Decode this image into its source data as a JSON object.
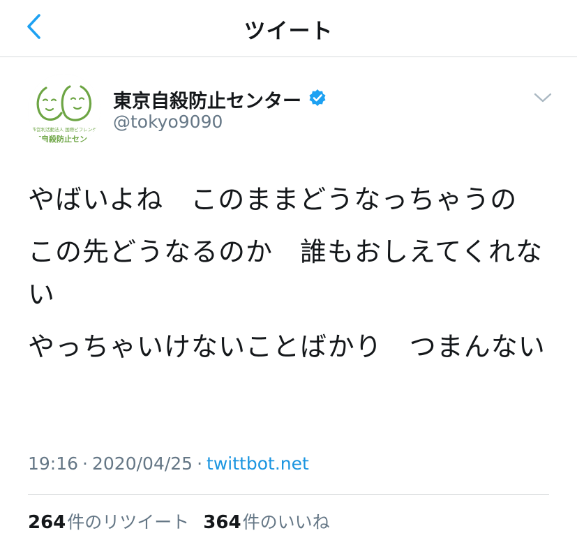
{
  "header": {
    "title": "ツイート",
    "back_icon": "chevron-left-icon",
    "accent_color": "#1da1f2"
  },
  "author": {
    "display_name": "東京自殺防止センター",
    "handle": "@tokyo9090",
    "verified": true,
    "avatar_caption_small": "特定非営利活動法人 国際ビフレンダーズ",
    "avatar_caption_large": "東京自殺防止センター"
  },
  "tweet": {
    "paragraphs": [
      "やばいよね　このままどうなっちゃうの",
      "この先どうなるのか　誰もおしえてくれない",
      "やっちゃいけないことばかり　つまんない"
    ],
    "time": "19:16",
    "separator": "·",
    "date": "2020/04/25",
    "source": "twittbot.net"
  },
  "stats": {
    "retweets_count": "264",
    "retweets_label": "件のリツイート",
    "likes_count": "364",
    "likes_label": "件のいいね"
  },
  "colors": {
    "text_primary": "#14171a",
    "text_secondary": "#657786",
    "link": "#1b95e0",
    "avatar_green": "#6da544",
    "verified_blue": "#1da1f2"
  }
}
